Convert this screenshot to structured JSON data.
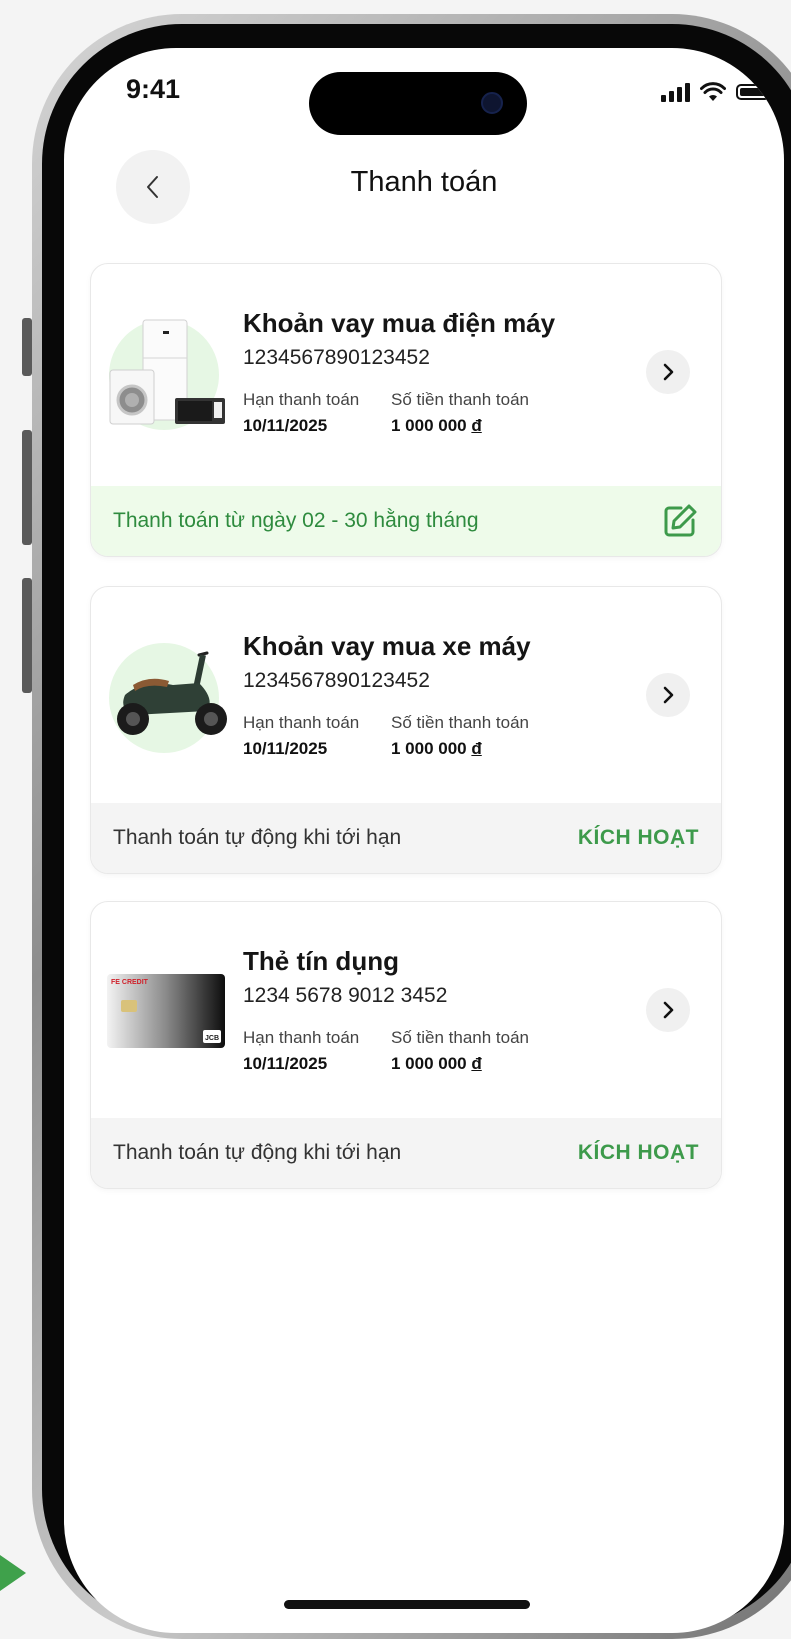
{
  "status_bar": {
    "time": "9:41"
  },
  "header": {
    "title": "Thanh toán"
  },
  "labels": {
    "due_date": "Hạn thanh toán",
    "amount": "Số tiền thanh toán",
    "currency": "đ"
  },
  "cards": [
    {
      "name": "Khoản vay mua điện máy",
      "number": "1234567890123452",
      "due_date": "10/11/2025",
      "amount": "1 000 000",
      "footer_text": "Thanh toán từ ngày 02 - 30 hằng tháng",
      "footer_icon": "edit-icon"
    },
    {
      "name": "Khoản vay mua xe máy",
      "number": "1234567890123452",
      "due_date": "10/11/2025",
      "amount": "1 000 000",
      "footer_text": "Thanh toán tự động khi tới hạn",
      "footer_action": "KÍCH HOẠT"
    },
    {
      "name": "Thẻ tín dụng",
      "number": "1234 5678 9012 3452",
      "due_date": "10/11/2025",
      "amount": "1 000 000",
      "footer_text": "Thanh toán tự động khi tới hạn",
      "footer_action": "KÍCH HOẠT",
      "card_brand": "FE CREDIT",
      "card_network": "JCB"
    }
  ],
  "colors": {
    "accent_green": "#3d9a4b",
    "soft_green": "#eefbea"
  }
}
